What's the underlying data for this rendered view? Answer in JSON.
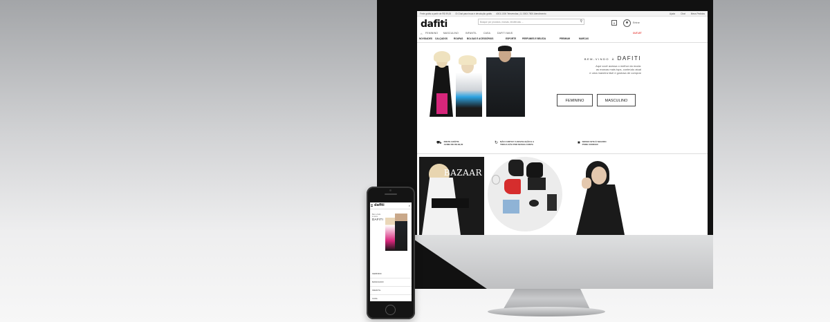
{
  "desktop": {
    "top_strip": {
      "left": [
        "Frete grátis a partir de R$ 99,00",
        "Oi Chat para troca e devolução grátis",
        "4003-1300 Televendas | 11 3003 7500 Atendimento"
      ],
      "help": "Ajuda",
      "chat": "Chat",
      "orders": "Meus Pedidos"
    },
    "logo": "dafiti",
    "search_placeholder": "Busque por produtos, marcas, tendências ...",
    "cart_count": "0",
    "login": "Entrar",
    "nav_primary": [
      "FEMININO",
      "MASCULINO",
      "INFANTIL",
      "CASA",
      "DAFITI MAIS"
    ],
    "nav_secondary": [
      "NOVIDADES",
      "CALÇADOS",
      "ROUPAS",
      "BOLSAS E ACESSÓRIOS",
      "ESPORTE",
      "PERFUMES E BELEZA",
      "PREMIUM",
      "MARCAS",
      "OUTLET"
    ],
    "hero": {
      "title_prefix": "BEM-VINDO",
      "title_a": "À",
      "title_brand": "DAFITI",
      "sub1": "Aqui você acessa o melhor da moda:",
      "sub2": "as marcas mais tops, conteúdo atual",
      "sub3": "e uma maneira fácil e gostosa de comprar",
      "btn_feminino": "FEMININO",
      "btn_masculino": "MASCULINO"
    },
    "benefits": [
      {
        "icon": "truck-icon",
        "line1": "FRETE GRÁTIS",
        "line2": "ACIMA DE R$ 99,00"
      },
      {
        "icon": "exchange-icon",
        "line1": "NÃO CURTIU? A DEVOLUÇÃO E A",
        "line2": "TROCA SÃO POR NOSSA CONTA"
      },
      {
        "icon": "lock-icon",
        "line1": "NOSSO SITE É SEGURO",
        "line2": "PODE CONFIAR"
      }
    ],
    "tile_magazine": "BAZAAR"
  },
  "mobile": {
    "logo": "dafiti",
    "hero_line1": "Bem vindo",
    "hero_line2": "à nova",
    "hero_brand": "DAFITI",
    "menu": [
      "FEMININO",
      "MASCULINO",
      "INFANTIL",
      "CASA"
    ]
  }
}
